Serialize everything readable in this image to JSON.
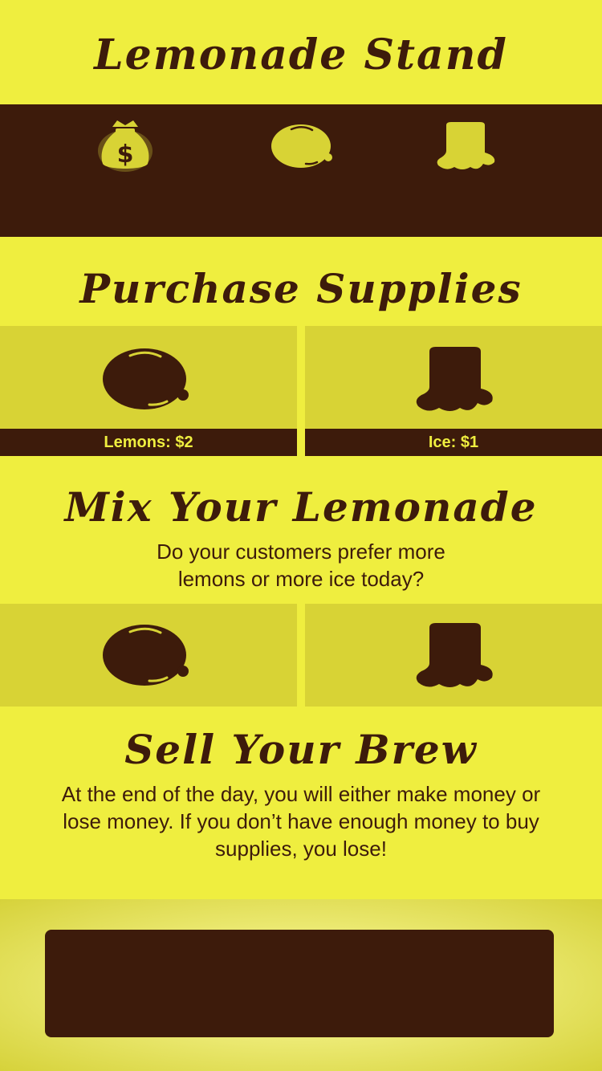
{
  "header": {
    "title": "Lemonade Stand"
  },
  "stats": {
    "icons": [
      "money-bag-icon",
      "lemon-icon",
      "ice-cube-icon"
    ],
    "active_color": "#efee3f"
  },
  "purchase": {
    "title": "Purchase Supplies",
    "items": [
      {
        "label": "Lemons: $2",
        "icon": "lemon-icon"
      },
      {
        "label": "Ice: $1",
        "icon": "ice-cube-icon"
      }
    ]
  },
  "mix": {
    "title": "Mix Your Lemonade",
    "description_line1": "Do your customers prefer more",
    "description_line2": "lemons or more ice today?",
    "items": [
      {
        "icon": "lemon-icon"
      },
      {
        "icon": "ice-cube-icon"
      }
    ]
  },
  "sell": {
    "title": "Sell Your Brew",
    "description_line1": "At the end of the day, you will either make money or",
    "description_line2": "lose money. If you don’t have enough money to buy",
    "description_line3": "supplies, you lose!"
  },
  "colors": {
    "background": "#efee3f",
    "dark_brown": "#3d1b0b",
    "tile": "#d8d335"
  }
}
